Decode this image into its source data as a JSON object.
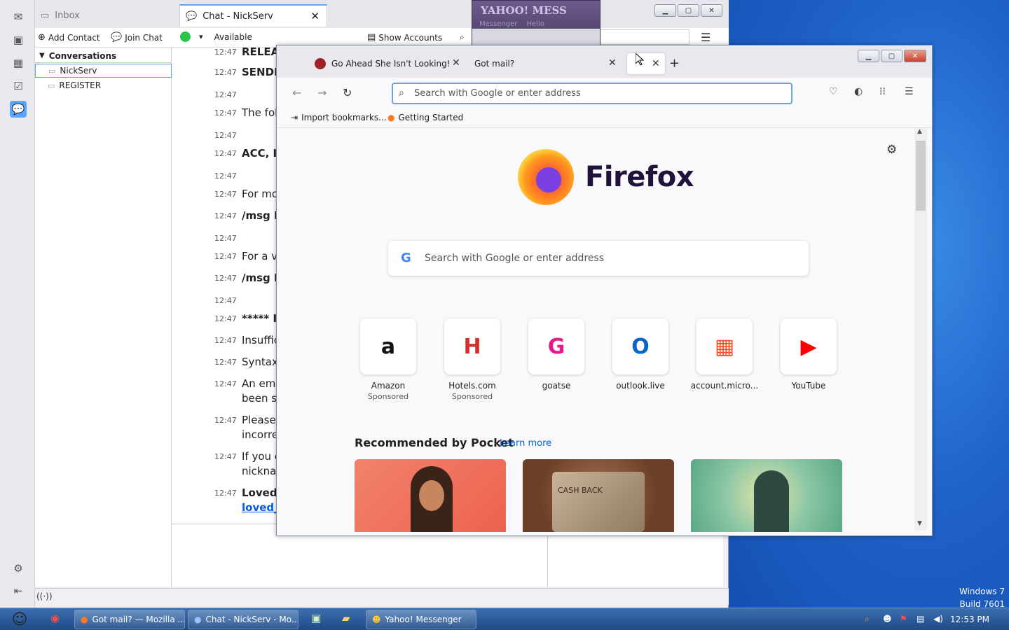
{
  "desktop": {
    "watermark_line1": "Windows 7",
    "watermark_line2": "Build 7601"
  },
  "thunderbird": {
    "tabs": [
      {
        "label": "Inbox"
      },
      {
        "label": "Chat - NickServ"
      }
    ],
    "toolbar": {
      "add_contact": "Add Contact",
      "join_chat": "Join Chat",
      "status": "Available",
      "show_accounts": "Show Accounts"
    },
    "conversations": {
      "header": "Conversations",
      "items": [
        {
          "label": "NickServ"
        },
        {
          "label": "REGISTER"
        }
      ]
    },
    "messages": [
      {
        "time": "12:47",
        "text": "RELEA",
        "style": "bold"
      },
      {
        "time": "12:47",
        "text": "SENDI",
        "style": "bold"
      },
      {
        "time": "12:47",
        "text": "",
        "style": ""
      },
      {
        "time": "12:47",
        "text": "The fol",
        "style": ""
      },
      {
        "time": "12:47",
        "text": "",
        "style": ""
      },
      {
        "time": "12:47",
        "text": "ACC, I",
        "style": "bold"
      },
      {
        "time": "12:47",
        "text": "",
        "style": ""
      },
      {
        "time": "12:47",
        "text": "For mo",
        "style": ""
      },
      {
        "time": "12:47",
        "text": "/msg N",
        "style": "bold"
      },
      {
        "time": "12:47",
        "text": "",
        "style": ""
      },
      {
        "time": "12:47",
        "text": "For a ve",
        "style": ""
      },
      {
        "time": "12:47",
        "text": "/msg N",
        "style": "bold"
      },
      {
        "time": "12:47",
        "text": "",
        "style": ""
      },
      {
        "time": "12:47",
        "text": "***** I",
        "style": "bold"
      },
      {
        "time": "12:47",
        "text": "Insuffic",
        "style": ""
      },
      {
        "time": "12:47",
        "text": "Syntax:",
        "style": ""
      },
      {
        "time": "12:47",
        "text": "An ema",
        "style": ""
      },
      {
        "time": "",
        "text": "been se",
        "style": ""
      },
      {
        "time": "12:47",
        "text": "Please",
        "style": ""
      },
      {
        "time": "",
        "text": "incorre",
        "style": ""
      },
      {
        "time": "12:47",
        "text": "If you c",
        "style": ""
      },
      {
        "time": "",
        "text": "nicknar",
        "style": ""
      },
      {
        "time": "12:47",
        "text": "LovedE",
        "style": "bold"
      },
      {
        "time": "",
        "text": "loved_",
        "style": "link"
      }
    ]
  },
  "yahoo": {
    "title": "YAHOO! MESS",
    "subtitle": "Messenger",
    "extra": "Hello"
  },
  "firefox": {
    "tabs": [
      {
        "label": "Go Ahead She Isn't Looking! | M"
      },
      {
        "label": "Got mail?"
      },
      {
        "label": ""
      }
    ],
    "urlbar_placeholder": "Search with Google or enter address",
    "bookmarks": [
      {
        "label": "Import bookmarks..."
      },
      {
        "label": "Getting Started"
      }
    ],
    "wordmark": "Firefox",
    "search_placeholder": "Search with Google or enter address",
    "top_sites": [
      {
        "name": "Amazon",
        "sponsored": "Sponsored",
        "icon": "amazon-icon",
        "glyph": "a",
        "color": "#111111"
      },
      {
        "name": "Hotels.com",
        "sponsored": "Sponsored",
        "icon": "hotels-icon",
        "glyph": "H",
        "color": "#d32f2f"
      },
      {
        "name": "goatse",
        "sponsored": "",
        "icon": "goatse-icon",
        "glyph": "G",
        "color": "#e8188a"
      },
      {
        "name": "outlook.live",
        "sponsored": "",
        "icon": "outlook-icon",
        "glyph": "O",
        "color": "#0a66c2"
      },
      {
        "name": "account.micro...",
        "sponsored": "",
        "icon": "microsoft-icon",
        "glyph": "▦",
        "color": "#f25022"
      },
      {
        "name": "YouTube",
        "sponsored": "",
        "icon": "youtube-icon",
        "glyph": "▶",
        "color": "#ff0000"
      }
    ],
    "pocket": {
      "heading": "Recommended by Pocket",
      "learn_more": "Learn more",
      "card2_text": "CASH BACK"
    }
  },
  "taskbar": {
    "buttons": [
      {
        "label": "Got mail? — Mozilla ..."
      },
      {
        "label": "Chat - NickServ - Mo..."
      },
      {
        "label": "Yahoo! Messenger"
      }
    ],
    "clock": "12:53 PM"
  }
}
